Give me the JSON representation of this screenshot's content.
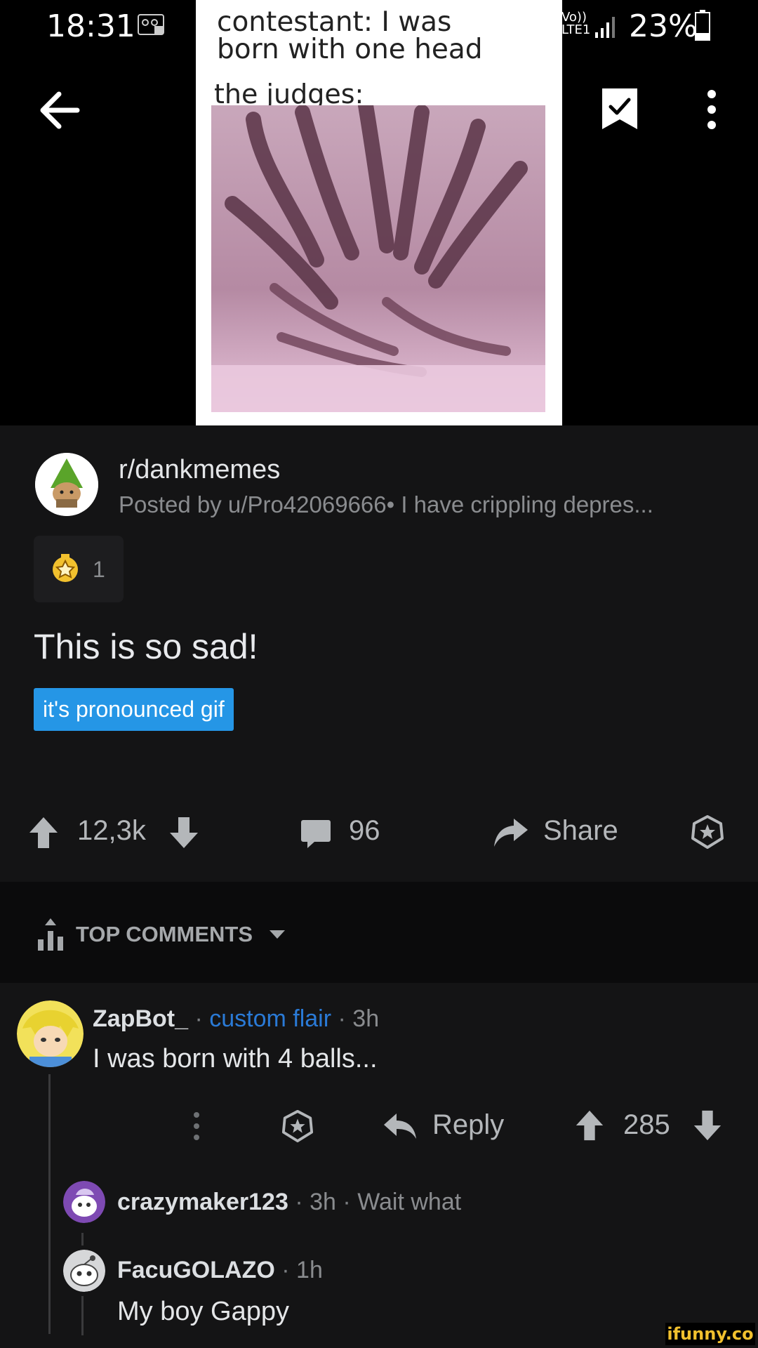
{
  "status_bar": {
    "time": "18:31",
    "network": "Vo)) LTE1",
    "battery": "23%"
  },
  "meme": {
    "caption": "contestant: I was\nborn with one head",
    "judges_label": "the judges:"
  },
  "post": {
    "subreddit": "r/dankmemes",
    "meta": "Posted by u/Pro42069666• I have crippling depres...",
    "award_count": "1",
    "title": "This is so sad!",
    "flair": "it's pronounced gif",
    "votes": "12,3k",
    "comments": "96",
    "share_label": "Share"
  },
  "sort": {
    "label": "TOP COMMENTS"
  },
  "comments": [
    {
      "author": "ZapBot_",
      "separator": "·",
      "flair": "custom flair",
      "age": "3h",
      "body": "I was born with 4 balls...",
      "reply_label": "Reply",
      "score": "285"
    },
    {
      "author": "crazymaker123",
      "separator": "·",
      "age": "3h",
      "body": "Wait what"
    },
    {
      "author": "FacuGOLAZO",
      "separator": "·",
      "age": "1h",
      "body": "My boy Gappy"
    }
  ],
  "watermark": "ifunny.co",
  "colors": {
    "flair_bg": "#2596e6",
    "custom_flair_text": "#2a7ad6",
    "background": "#141415",
    "sort_bar": "#0b0b0c"
  },
  "icons": [
    "back-arrow-icon",
    "bookmark-check-icon",
    "kebab-menu-icon",
    "award-icon",
    "upvote-icon",
    "downvote-icon",
    "comment-bubble-icon",
    "share-arrow-icon",
    "give-award-icon",
    "sort-bars-icon",
    "chevron-down-icon",
    "reply-arrow-icon"
  ]
}
